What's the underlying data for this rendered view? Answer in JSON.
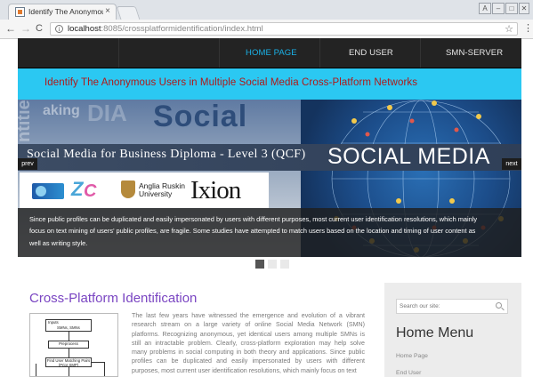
{
  "browser": {
    "tab_title": "Identify The Anonymou",
    "tab_close": "×",
    "url_host": "localhost",
    "url_rest": ":8085/crossplatformidentification/index.html",
    "window_controls": [
      "A",
      "–",
      "□",
      "✕"
    ]
  },
  "nav": {
    "items": [
      {
        "label": "HOME PAGE",
        "active": true
      },
      {
        "label": "END USER",
        "active": false
      },
      {
        "label": "SMN-SERVER",
        "active": false
      }
    ]
  },
  "banner": {
    "title": "Identify The Anonymous Users in Multiple Social Media Cross-Platform Networks"
  },
  "slider": {
    "big_word": "Social",
    "slide_title": "Social Media for Business Diploma - Level 3 (QCF)",
    "social_media_label": "SOCIAL MEDIA",
    "prev_label": "prev",
    "next_label": "next",
    "logos": {
      "anglia_line1": "Anglia Ruskin",
      "anglia_line2": "University",
      "ixion": "Ixion"
    },
    "caption": "Since public profiles can be duplicated and easily impersonated by users with different purposes, most current user identification resolutions, which mainly focus on text mining of users' public profiles, are fragile. Some studies have attempted to match users based on the location and timing of user content as well as writing style.",
    "dots": [
      {
        "active": true
      },
      {
        "active": false
      },
      {
        "active": false
      }
    ]
  },
  "main": {
    "title": "Cross-Platform Identification",
    "flowchart": {
      "box1": "Inputs",
      "box1b": "SMNs, SMNs",
      "box2": "Preprocess",
      "box3": "Find User Matching Pairs",
      "box3b": "(Prior SMP)"
    },
    "paragraph": "The last few years have witnessed the emergence and evolution of a vibrant research stream on a large variety of online Social Media Network (SMN) platforms. Recognizing anonymous, yet identical users among multiple SMNs is still an intractable problem. Clearly, cross-platform exploration may help solve many problems in social computing in both theory and applications. Since public profiles can be duplicated and easily impersonated by users with different purposes, most current user identification resolutions, which mainly focus on text"
  },
  "sidebar": {
    "search_placeholder": "Search our site:",
    "menu_title": "Home Menu",
    "links": [
      "Home Page",
      "End User"
    ]
  }
}
